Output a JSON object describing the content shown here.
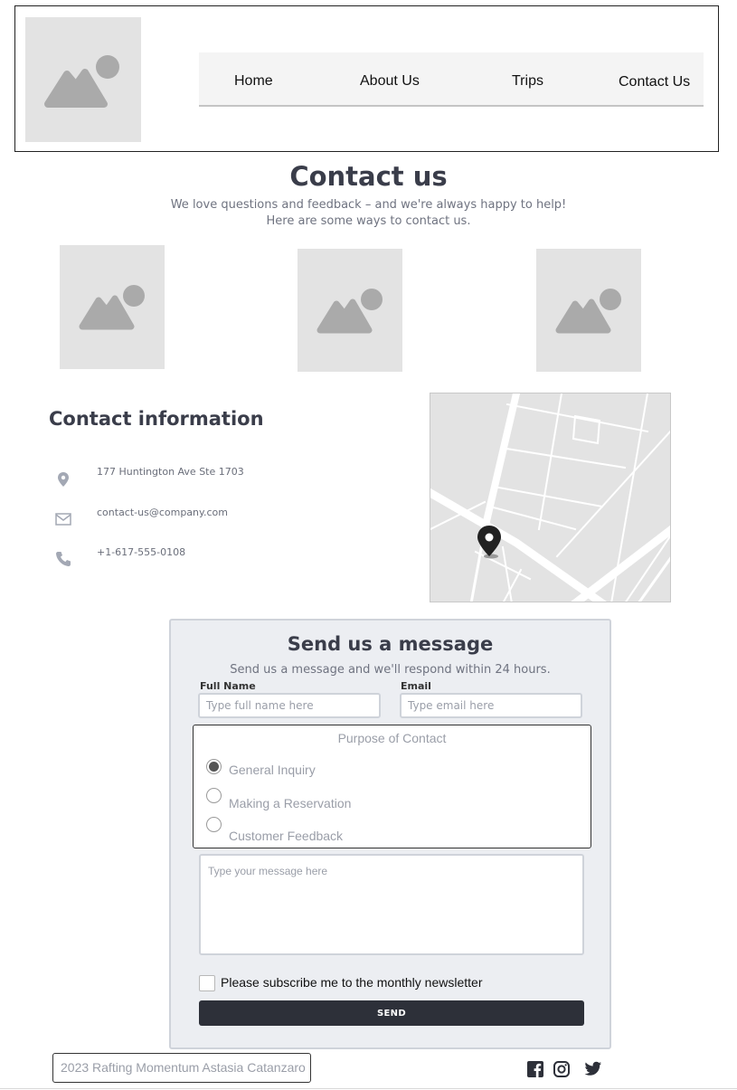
{
  "header": {
    "logo_icon": "image-placeholder-icon",
    "nav": [
      "Home",
      "About Us",
      "Trips",
      "Contact Us"
    ]
  },
  "hero": {
    "title": "Contact us",
    "subtitle_line1": "We love questions and feedback – and we're always happy to help!",
    "subtitle_line2": "Here are some ways to contact us.",
    "image_icons": [
      "image-placeholder-icon",
      "image-placeholder-icon",
      "image-placeholder-icon"
    ]
  },
  "contact_info": {
    "title": "Contact information",
    "address": "177 Huntington Ave Ste 1703",
    "email": "contact-us@company.com",
    "phone": "+1-617-555-0108",
    "icons": [
      "location-pin-icon",
      "mail-icon",
      "phone-icon"
    ]
  },
  "map": {
    "icon": "map-marker-icon"
  },
  "form": {
    "title": "Send us a message",
    "subtitle": "Send us a message and we'll respond within 24 hours.",
    "full_name_label": "Full Name",
    "full_name_placeholder": "Type full name here",
    "email_label": "Email",
    "email_placeholder": "Type email here",
    "purpose_legend": "Purpose of Contact",
    "options": [
      "General Inquiry",
      "Making a Reservation",
      "Customer Feedback"
    ],
    "selected_option": "General Inquiry",
    "message_placeholder": "Type your message here",
    "newsletter_label": "Please subscribe me to the monthly newsletter",
    "newsletter_checked": false,
    "send_label": "SEND"
  },
  "footer": {
    "copyright": "2023 Rafting Momentum Astasia Catanzaro",
    "social_icons": [
      "facebook-icon",
      "instagram-icon",
      "twitter-icon"
    ]
  },
  "colors": {
    "heading": "#3a3d4a",
    "muted_text": "#6f7380",
    "form_bg": "#eceef2",
    "button_bg": "#2d3039",
    "placeholder_gray": "#e3e3e3"
  }
}
